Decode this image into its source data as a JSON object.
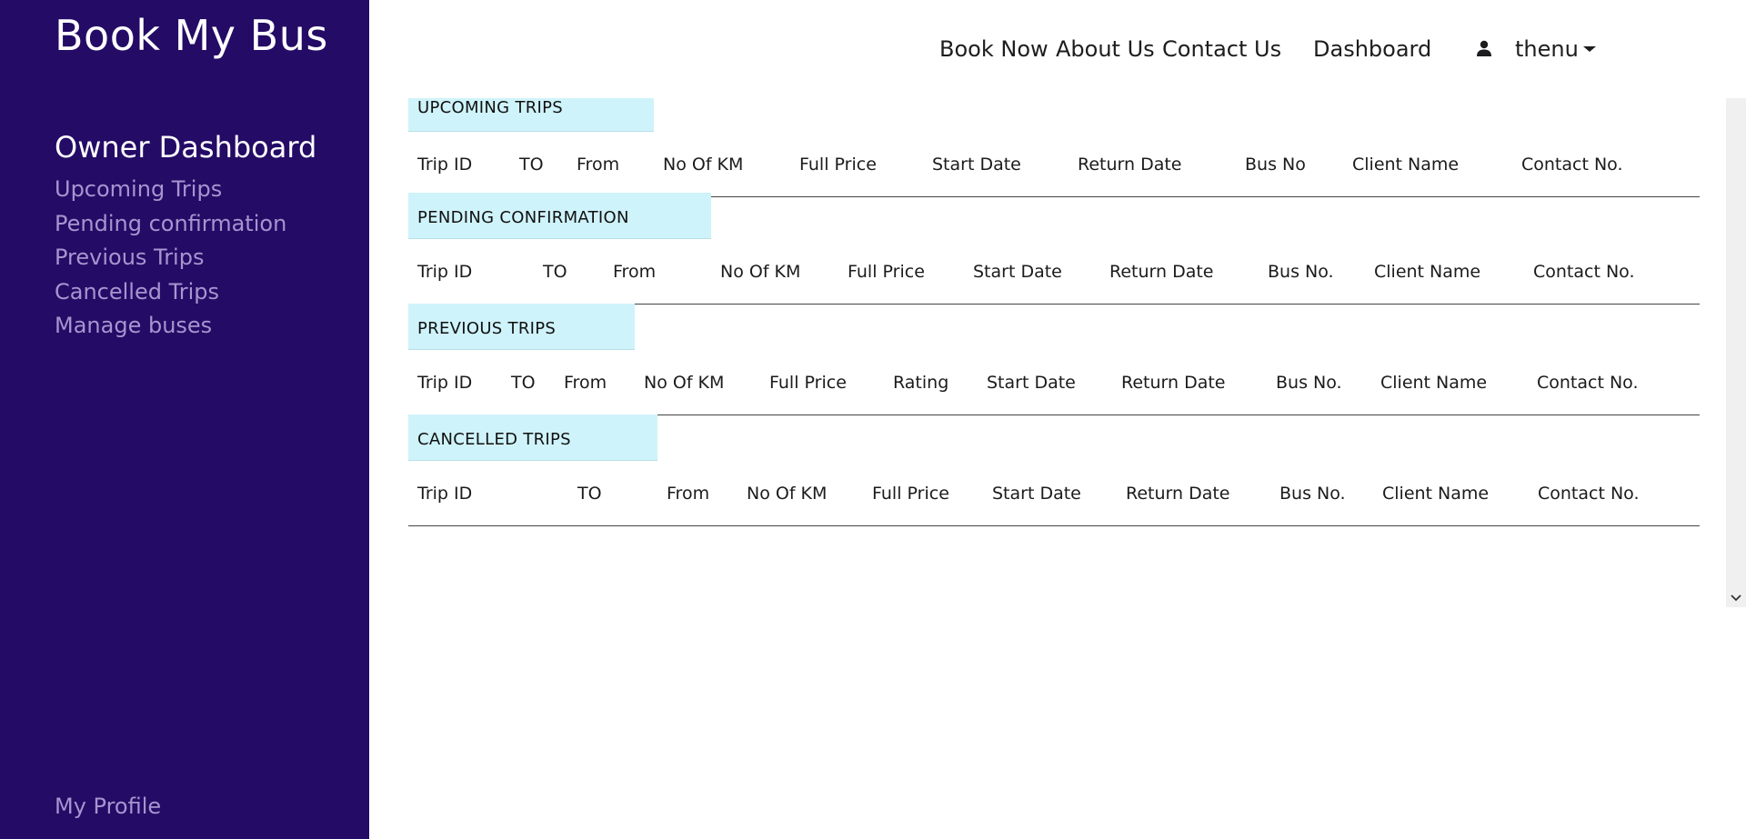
{
  "brand": {
    "title": "Book My Bus"
  },
  "sidebar": {
    "heading": "Owner Dashboard",
    "items": [
      {
        "label": "Upcoming Trips"
      },
      {
        "label": "Pending confirmation"
      },
      {
        "label": "Previous Trips"
      },
      {
        "label": "Cancelled Trips"
      },
      {
        "label": "Manage buses"
      }
    ],
    "profile": "My Profile"
  },
  "topnav": {
    "links": [
      {
        "label": "Book Now"
      },
      {
        "label": "About Us"
      },
      {
        "label": "Contact Us"
      },
      {
        "label": "Dashboard"
      }
    ],
    "user": {
      "icon": "user-icon",
      "name": "thenu",
      "caret": "caret-down-icon"
    }
  },
  "sections": [
    {
      "title": "UPCOMING TRIPS",
      "columns": [
        "Trip ID",
        "TO",
        "From",
        "No Of KM",
        "Full Price",
        "Start Date",
        "Return Date",
        "Bus No",
        "Client Name",
        "Contact No."
      ]
    },
    {
      "title": "PENDING CONFIRMATION",
      "columns": [
        "Trip ID",
        "TO",
        "From",
        "No Of KM",
        "Full Price",
        "Start Date",
        "Return Date",
        "Bus No.",
        "Client Name",
        "Contact No."
      ]
    },
    {
      "title": "PREVIOUS TRIPS",
      "columns": [
        "Trip ID",
        "TO",
        "From",
        "No Of KM",
        "Full Price",
        "Rating",
        "Start Date",
        "Return Date",
        "Bus No.",
        "Client Name",
        "Contact No."
      ]
    },
    {
      "title": "CANCELLED TRIPS",
      "columns": [
        "Trip ID",
        "TO",
        "From",
        "No Of KM",
        "Full Price",
        "Start Date",
        "Return Date",
        "Bus No.",
        "Client Name",
        "Contact No."
      ]
    }
  ],
  "colors": {
    "sidebar_bg": "#240b66",
    "sidebar_link": "#a695cf",
    "section_header_bg": "#cff3fa"
  }
}
